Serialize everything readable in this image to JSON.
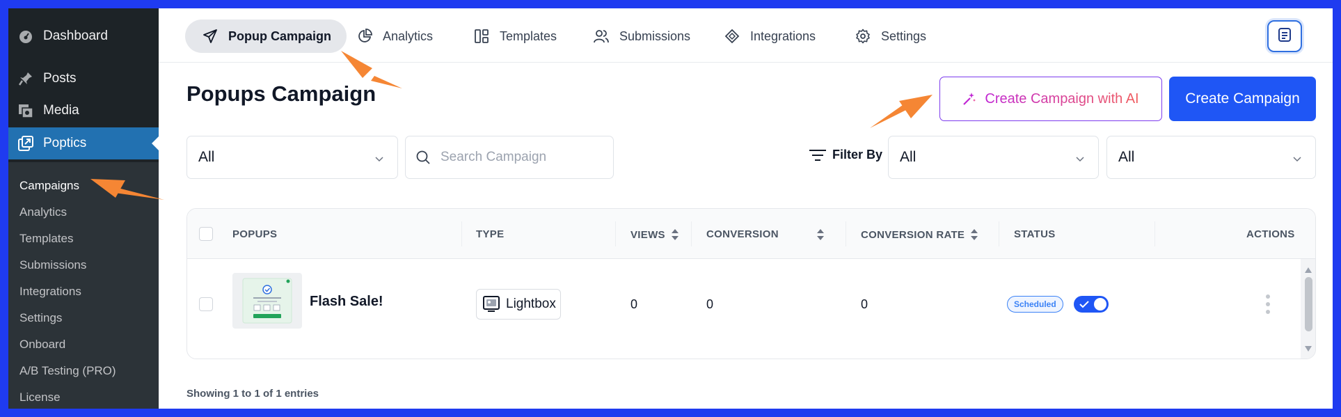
{
  "sidebar": {
    "top_items": [
      {
        "label": "Dashboard",
        "icon": "dashboard-icon"
      },
      {
        "label": "Posts",
        "icon": "pin-icon"
      },
      {
        "label": "Media",
        "icon": "media-icon"
      },
      {
        "label": "Poptics",
        "icon": "poptics-icon"
      }
    ],
    "submenu": [
      "Campaigns",
      "Analytics",
      "Templates",
      "Submissions",
      "Integrations",
      "Settings",
      "Onboard",
      "A/B Testing (PRO)",
      "License"
    ]
  },
  "topnav": {
    "tabs": [
      {
        "label": "Popup Campaign",
        "icon": "paper-plane-icon"
      },
      {
        "label": "Analytics",
        "icon": "pie-chart-icon"
      },
      {
        "label": "Templates",
        "icon": "templates-icon"
      },
      {
        "label": "Submissions",
        "icon": "users-icon"
      },
      {
        "label": "Integrations",
        "icon": "integrations-icon"
      },
      {
        "label": "Settings",
        "icon": "gear-icon"
      }
    ]
  },
  "main": {
    "title": "Popups Campaign",
    "ai_button": "Create Campaign with AI",
    "create_button": "Create Campaign",
    "filter_type": "All",
    "search_placeholder": "Search Campaign",
    "filter_by_label": "Filter By",
    "filter_status": "All",
    "filter_other": "All"
  },
  "table": {
    "headers": {
      "popups": "POPUPS",
      "type": "TYPE",
      "views": "VIEWS",
      "conversion": "CONVERSION",
      "conversion_rate": "CONVERSION RATE",
      "status": "STATUS",
      "actions": "ACTIONS"
    },
    "rows": [
      {
        "name": "Flash Sale!",
        "type": "Lightbox",
        "views": "0",
        "conversion": "0",
        "conversion_rate": "0",
        "status": "Scheduled",
        "enabled": true
      }
    ]
  },
  "footer": "Showing 1 to 1 of 1 entries",
  "colors": {
    "accent": "#1f56f5",
    "sidebar_bg": "#1d2327",
    "active_menu": "#2271b1",
    "annotation_arrow": "#f58634",
    "frame_border": "#1f3bf0"
  }
}
